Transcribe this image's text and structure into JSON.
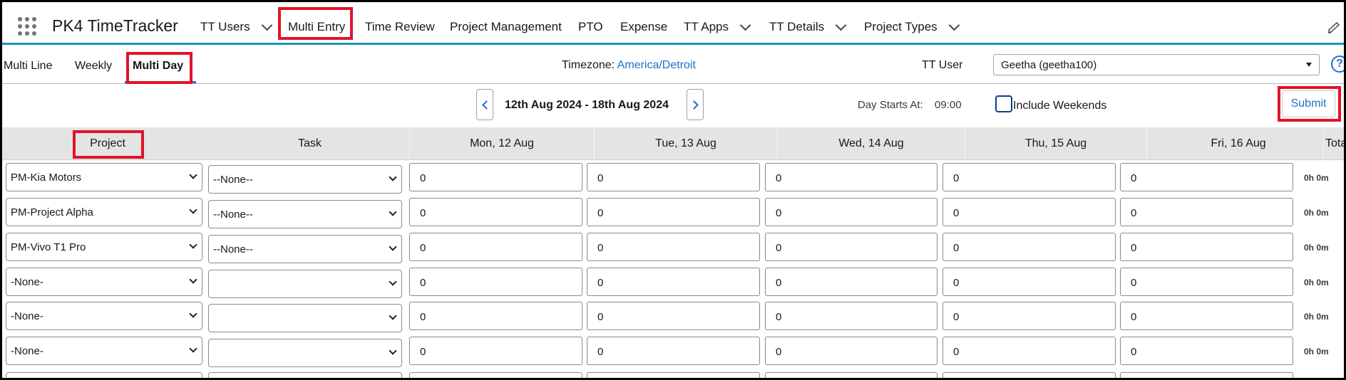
{
  "app": {
    "title": "PK4 TimeTracker"
  },
  "nav": {
    "items": [
      {
        "label": "TT Users",
        "has_menu": true
      },
      {
        "label": "Multi Entry",
        "has_menu": false,
        "highlighted": true
      },
      {
        "label": "Time Review",
        "has_menu": false
      },
      {
        "label": "Project Management",
        "has_menu": false
      },
      {
        "label": "PTO",
        "has_menu": false
      },
      {
        "label": "Expense",
        "has_menu": false
      },
      {
        "label": "TT Apps",
        "has_menu": true
      },
      {
        "label": "TT Details",
        "has_menu": true
      },
      {
        "label": "Project Types",
        "has_menu": true
      }
    ]
  },
  "subtabs": {
    "items": [
      {
        "label": "Multi Line"
      },
      {
        "label": "Weekly"
      },
      {
        "label": "Multi Day",
        "active": true
      }
    ]
  },
  "timezone": {
    "label": "Timezone:",
    "value": "America/Detroit"
  },
  "tt_user": {
    "label": "TT User",
    "selected": "Geetha (geetha100)"
  },
  "date_range": {
    "text": "12th Aug 2024 - 18th Aug 2024"
  },
  "day_start": {
    "label": "Day Starts At:",
    "value": "09:00"
  },
  "include_weekends": {
    "label": "Include Weekends",
    "checked": false
  },
  "submit": {
    "label": "Submit"
  },
  "table": {
    "columns": [
      "Project",
      "Task",
      "Mon, 12 Aug",
      "Tue, 13 Aug",
      "Wed, 14 Aug",
      "Thu, 15 Aug",
      "Fri, 16 Aug",
      "Tota"
    ],
    "rows": [
      {
        "project": "PM-Kia Motors",
        "task": "--None--",
        "days": [
          "0",
          "0",
          "0",
          "0",
          "0"
        ],
        "total": "0h 0m"
      },
      {
        "project": "PM-Project Alpha",
        "task": "--None--",
        "days": [
          "0",
          "0",
          "0",
          "0",
          "0"
        ],
        "total": "0h 0m"
      },
      {
        "project": "PM-Vivo T1 Pro",
        "task": "--None--",
        "days": [
          "0",
          "0",
          "0",
          "0",
          "0"
        ],
        "total": "0h 0m"
      },
      {
        "project": "-None-",
        "task": "",
        "days": [
          "0",
          "0",
          "0",
          "0",
          "0"
        ],
        "total": "0h 0m"
      },
      {
        "project": "-None-",
        "task": "",
        "days": [
          "0",
          "0",
          "0",
          "0",
          "0"
        ],
        "total": "0h 0m"
      },
      {
        "project": "-None-",
        "task": "",
        "days": [
          "0",
          "0",
          "0",
          "0",
          "0"
        ],
        "total": "0h 0m"
      }
    ]
  },
  "colors": {
    "accent": "#1b72c9",
    "highlight": "#e0132a",
    "nav_border": "#1b96b8"
  }
}
